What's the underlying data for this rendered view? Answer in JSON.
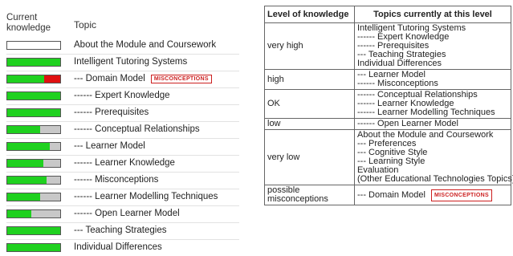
{
  "left_panel": {
    "header_knowledge": "Current knowledge",
    "header_topic": "Topic",
    "rows": [
      {
        "topic": "About the Module and Coursework",
        "level": 0,
        "misconception": false
      },
      {
        "topic": "Intelligent Tutoring Systems",
        "level": 1.0,
        "misconception": false
      },
      {
        "topic": "--- Domain Model",
        "level": 0.7,
        "misconception": true
      },
      {
        "topic": "------ Expert Knowledge",
        "level": 1.0,
        "misconception": false
      },
      {
        "topic": "------ Prerequisites",
        "level": 1.0,
        "misconception": false
      },
      {
        "topic": "------ Conceptual Relationships",
        "level": 0.62,
        "misconception": false
      },
      {
        "topic": "--- Learner Model",
        "level": 0.8,
        "misconception": false
      },
      {
        "topic": "------ Learner Knowledge",
        "level": 0.68,
        "misconception": false
      },
      {
        "topic": "------ Misconceptions",
        "level": 0.74,
        "misconception": false
      },
      {
        "topic": "------ Learner Modelling Techniques",
        "level": 0.62,
        "misconception": false
      },
      {
        "topic": "------ Open Learner Model",
        "level": 0.45,
        "misconception": false
      },
      {
        "topic": "--- Teaching Strategies",
        "level": 1.0,
        "misconception": false
      },
      {
        "topic": "Individual Differences",
        "level": 1.0,
        "misconception": false
      }
    ],
    "misconception_badge": "MISCONCEPTIONS"
  },
  "right_table": {
    "header_level": "Level of knowledge",
    "header_topics": "Topics currently at this level",
    "rows": [
      {
        "level": "very high",
        "topics": [
          "Intelligent Tutoring Systems",
          "------ Expert Knowledge",
          "------ Prerequisites",
          "--- Teaching Strategies",
          "Individual Differences"
        ]
      },
      {
        "level": "high",
        "topics": [
          "--- Learner Model",
          "------ Misconceptions"
        ]
      },
      {
        "level": "OK",
        "topics": [
          "------ Conceptual Relationships",
          "------ Learner Knowledge",
          "------ Learner Modelling Techniques"
        ]
      },
      {
        "level": "low",
        "topics": [
          "------ Open Learner Model"
        ]
      },
      {
        "level": "very low",
        "topics": [
          "About the Module and Coursework",
          "--- Preferences",
          "--- Cognitive Style",
          "--- Learning Style",
          "Evaluation",
          "(Other Educational Technologies Topics)"
        ]
      },
      {
        "level": "possible misconceptions",
        "topics": [
          "--- Domain Model"
        ],
        "badge": "MISCONCEPTIONS"
      }
    ]
  },
  "colors": {
    "known": "#1fd11f",
    "misconception": "#e01010",
    "unknown": "#c8c8c8",
    "badge": "#cc1f1f"
  }
}
